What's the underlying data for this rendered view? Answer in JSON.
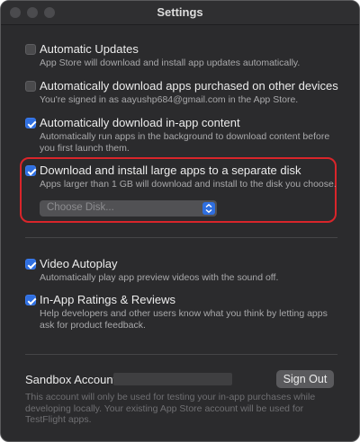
{
  "window": {
    "title": "Settings"
  },
  "settings": [
    {
      "label": "Automatic Updates",
      "checked": false,
      "description": "App Store will download and install app updates automatically."
    },
    {
      "label": "Automatically download apps purchased on other devices",
      "checked": false,
      "description": "You're signed in as aayushp684@gmail.com in the App Store."
    },
    {
      "label": "Automatically download in-app content",
      "checked": true,
      "description": "Automatically run apps in the background to download content before you first launch them."
    },
    {
      "label": "Download and install large apps to a separate disk",
      "checked": true,
      "description": "Apps larger than 1 GB will download and install to the disk you choose."
    },
    {
      "label": "Video Autoplay",
      "checked": true,
      "description": "Automatically play app preview videos with the sound off."
    },
    {
      "label": "In-App Ratings & Reviews",
      "checked": true,
      "description": "Help developers and other users know what you think by letting apps ask for product feedback."
    }
  ],
  "disk_select": {
    "value": "Choose Disk..."
  },
  "sandbox": {
    "label": "Sandbox Account:",
    "sign_out_label": "Sign Out",
    "note": "This account will only be used for testing your in-app purchases while developing locally. Your existing App Store account will be used for TestFlight apps."
  },
  "colors": {
    "window_bg": "#2b2b2d",
    "accent": "#2f6fe0",
    "highlight_border": "#d9252a"
  }
}
